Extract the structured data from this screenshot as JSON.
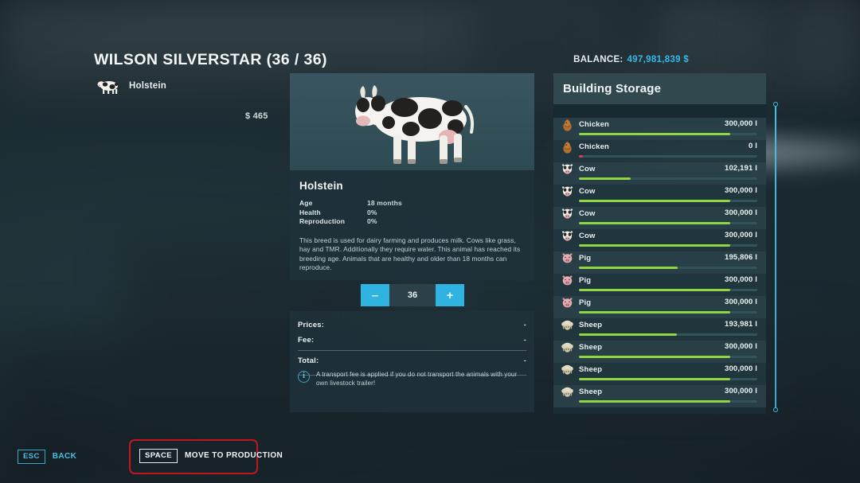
{
  "header": {
    "shop_title": "WILSON SILVERSTAR (36 / 36)",
    "balance_label": "BALANCE:",
    "balance_value": "497,981,839 $",
    "balance_color": "#35b9e8"
  },
  "animal_list": {
    "items": [
      {
        "name": "Holstein",
        "icon": "cow-thumb-icon",
        "price": "$ 465"
      }
    ]
  },
  "detail": {
    "breed_name": "Holstein",
    "stage_icon": "cow-render-icon",
    "stats": [
      {
        "label": "Age",
        "value": "18 months"
      },
      {
        "label": "Health",
        "value": "0%"
      },
      {
        "label": "Reproduction",
        "value": "0%"
      }
    ],
    "description": "This breed is used for dairy farming and produces milk. Cows like grass, hay and TMR. Additionally they require water. This animal has reached its breeding age. Animals that are healthy and older than 18 months can reproduce."
  },
  "stepper": {
    "decrease_label": "–",
    "increase_label": "+",
    "count": "36"
  },
  "prices": {
    "rows": [
      {
        "label": "Prices:",
        "value": "-"
      },
      {
        "label": "Fee:",
        "value": "-"
      },
      {
        "label": "Total:",
        "value": "-"
      }
    ],
    "info_icon": "info-icon",
    "info_text": "A transport fee is applied if you do not transport the animals with your own livestock trailer!"
  },
  "storage": {
    "title": "Building Storage",
    "fill_color": "#8ed642",
    "empty_marker_color": "#d6434a",
    "capacity": 300000,
    "rows": [
      {
        "icon": "chicken-icon",
        "name": "Chicken",
        "amount": "300,000 l",
        "value": 300000
      },
      {
        "icon": "chicken-icon",
        "name": "Chicken",
        "amount": "0 l",
        "value": 0
      },
      {
        "icon": "cow-icon",
        "name": "Cow",
        "amount": "102,191 l",
        "value": 102191
      },
      {
        "icon": "cow-icon",
        "name": "Cow",
        "amount": "300,000 l",
        "value": 300000
      },
      {
        "icon": "cow-icon",
        "name": "Cow",
        "amount": "300,000 l",
        "value": 300000
      },
      {
        "icon": "cow-icon",
        "name": "Cow",
        "amount": "300,000 l",
        "value": 300000
      },
      {
        "icon": "pig-icon",
        "name": "Pig",
        "amount": "195,806 l",
        "value": 195806
      },
      {
        "icon": "pig-icon",
        "name": "Pig",
        "amount": "300,000 l",
        "value": 300000
      },
      {
        "icon": "pig-icon",
        "name": "Pig",
        "amount": "300,000 l",
        "value": 300000
      },
      {
        "icon": "sheep-icon",
        "name": "Sheep",
        "amount": "193,981 l",
        "value": 193981
      },
      {
        "icon": "sheep-icon",
        "name": "Sheep",
        "amount": "300,000 l",
        "value": 300000
      },
      {
        "icon": "sheep-icon",
        "name": "Sheep",
        "amount": "300,000 l",
        "value": 300000
      },
      {
        "icon": "sheep-icon",
        "name": "Sheep",
        "amount": "300,000 l",
        "value": 300000
      }
    ]
  },
  "help_bar": {
    "back_key": "ESC",
    "back_label": "BACK",
    "production_key": "SPACE",
    "production_label": "MOVE TO PRODUCTION",
    "highlight_color": "#c0161f"
  }
}
